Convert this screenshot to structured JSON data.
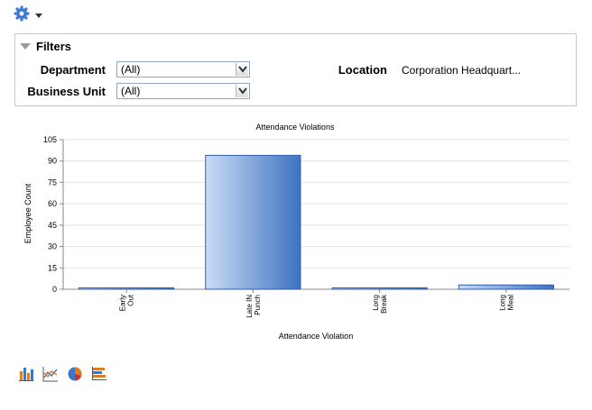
{
  "filters": {
    "title": "Filters",
    "department_label": "Department",
    "department_value": "(All)",
    "business_unit_label": "Business Unit",
    "business_unit_value": "(All)",
    "location_label": "Location",
    "location_value": "Corporation Headquart..."
  },
  "icons": {
    "gear": "gear-icon",
    "toolbar": [
      "bar-chart-icon",
      "line-chart-icon",
      "pie-chart-icon",
      "horizontal-bar-chart-icon"
    ]
  },
  "colors": {
    "bar_light": "#c9dcf7",
    "bar_dark": "#3f73c0",
    "gear": "#3b7bd5"
  },
  "chart_data": {
    "type": "bar",
    "title": "Attendance Violations",
    "xlabel": "Attendance Violation",
    "ylabel": "Employee Count",
    "ylim": [
      0,
      105
    ],
    "yticks": [
      0,
      15,
      30,
      45,
      60,
      75,
      90,
      105
    ],
    "grid": true,
    "categories": [
      [
        "Early",
        "Out"
      ],
      [
        "Late IN",
        "Punch"
      ],
      [
        "Long",
        "Break"
      ],
      [
        "Long",
        "Meal"
      ]
    ],
    "values": [
      1,
      94,
      1,
      3
    ]
  }
}
